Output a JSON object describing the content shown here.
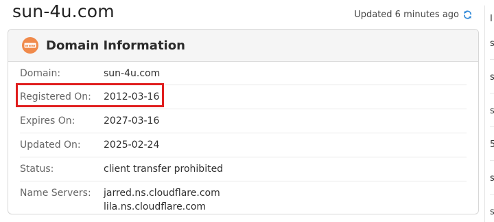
{
  "header": {
    "site_title": "sun-4u.com",
    "updated_text": "Updated 6 minutes ago",
    "refresh_icon": "refresh-icon",
    "accent_color": "#2f88d8"
  },
  "card": {
    "title": "Domain Information",
    "icon": "www-icon",
    "icon_color": "#f08a4b",
    "rows": [
      {
        "label": "Domain:",
        "value": "sun-4u.com"
      },
      {
        "label": "Registered On:",
        "value": "2012-03-16"
      },
      {
        "label": "Expires On:",
        "value": "2027-03-16"
      },
      {
        "label": "Updated On:",
        "value": "2025-02-24"
      },
      {
        "label": "Status:",
        "value": "client transfer prohibited"
      },
      {
        "label": "Name Servers:",
        "values": [
          "jarred.ns.cloudflare.com",
          "lila.ns.cloudflare.com"
        ]
      }
    ],
    "highlight_color": "#e01e1e"
  },
  "side_panel": {
    "heading": "I",
    "items": [
      "s",
      "s",
      "s",
      "5",
      "s",
      "s"
    ]
  }
}
